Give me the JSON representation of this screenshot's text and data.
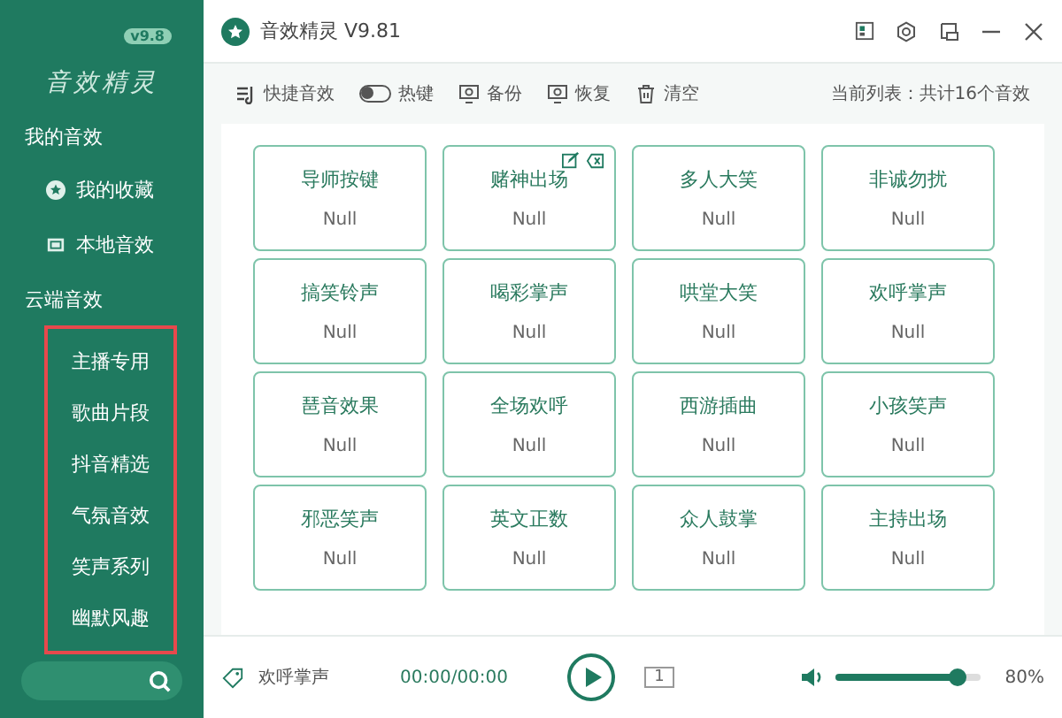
{
  "sidebar": {
    "logo": {
      "text": "音效精灵",
      "version": "v9.8"
    },
    "sections": [
      {
        "kind": "local",
        "title": "我的音效",
        "items": [
          {
            "label": "我的收藏"
          },
          {
            "label": "本地音效"
          }
        ]
      },
      {
        "kind": "cloud",
        "title": "云端音效",
        "items": [
          {
            "label": "主播专用"
          },
          {
            "label": "歌曲片段"
          },
          {
            "label": "抖音精选"
          },
          {
            "label": "气氛音效"
          },
          {
            "label": "笑声系列"
          },
          {
            "label": "幽默风趣"
          }
        ],
        "highlighted": true
      }
    ]
  },
  "window": {
    "title": "音效精灵 V9.81"
  },
  "toolbar": {
    "items": [
      {
        "kind": "icon",
        "label": "快捷音效"
      },
      {
        "kind": "toggle",
        "label": "热键",
        "on": false
      },
      {
        "kind": "icon",
        "label": "备份"
      },
      {
        "kind": "icon",
        "label": "恢复"
      },
      {
        "kind": "icon",
        "label": "清空"
      }
    ],
    "summary": "当前列表：共计16个音效"
  },
  "cards": [
    {
      "name": "导师按键",
      "value": "Null",
      "hovered": false
    },
    {
      "name": "赌神出场",
      "value": "Null",
      "hovered": true
    },
    {
      "name": "多人大笑",
      "value": "Null",
      "hovered": false
    },
    {
      "name": "非诚勿扰",
      "value": "Null",
      "hovered": false
    },
    {
      "name": "搞笑铃声",
      "value": "Null",
      "hovered": false
    },
    {
      "name": "喝彩掌声",
      "value": "Null",
      "hovered": false
    },
    {
      "name": "哄堂大笑",
      "value": "Null",
      "hovered": false
    },
    {
      "name": "欢呼掌声",
      "value": "Null",
      "hovered": false
    },
    {
      "name": "琶音效果",
      "value": "Null",
      "hovered": false
    },
    {
      "name": "全场欢呼",
      "value": "Null",
      "hovered": false
    },
    {
      "name": "西游插曲",
      "value": "Null",
      "hovered": false
    },
    {
      "name": "小孩笑声",
      "value": "Null",
      "hovered": false
    },
    {
      "name": "邪恶笑声",
      "value": "Null",
      "hovered": false
    },
    {
      "name": "英文正数",
      "value": "Null",
      "hovered": false
    },
    {
      "name": "众人鼓掌",
      "value": "Null",
      "hovered": false
    },
    {
      "name": "主持出场",
      "value": "Null",
      "hovered": false
    }
  ],
  "player": {
    "track": "欢呼掌声",
    "time": "00:00/00:00",
    "repeat": "1",
    "volume": {
      "level": 0.85,
      "reading": "80%"
    }
  }
}
